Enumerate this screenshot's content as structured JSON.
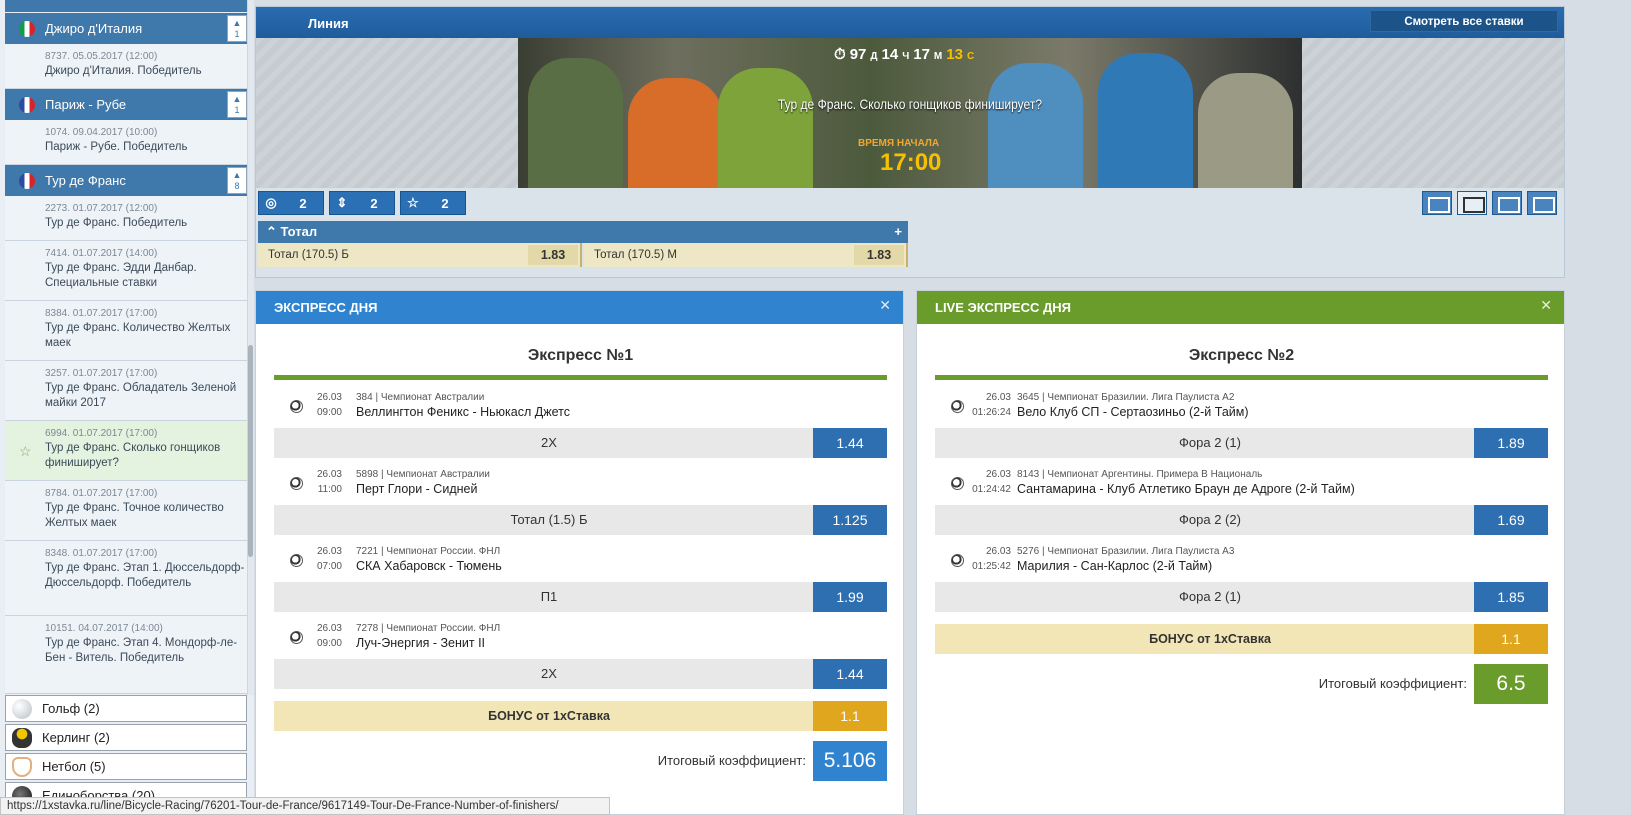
{
  "sidebar": {
    "champs": [
      {
        "name": "Джиро д'Италия",
        "count": "1"
      },
      {
        "name": "Париж - Рубе",
        "count": "1"
      },
      {
        "name": "Тур де Франс",
        "count": "8"
      }
    ],
    "events": [
      {
        "meta": "8737. 05.05.2017 (12:00)",
        "name": "Джиро д'Италия. Победитель"
      },
      {
        "meta": "1074. 09.04.2017 (10:00)",
        "name": "Париж - Рубе. Победитель"
      },
      {
        "meta": "2273. 01.07.2017 (12:00)",
        "name": "Тур де Франс. Победитель"
      },
      {
        "meta": "7414. 01.07.2017 (14:00)",
        "name": "Тур де Франс. Эдди Данбар. Специальные ставки"
      },
      {
        "meta": "8384. 01.07.2017 (17:00)",
        "name": "Тур де Франс. Количество Желтых маек"
      },
      {
        "meta": "3257. 01.07.2017 (17:00)",
        "name": "Тур де Франс. Обладатель Зеленой майки 2017"
      },
      {
        "meta": "6994. 01.07.2017 (17:00)",
        "name": "Тур де Франс. Сколько гонщиков финиширует?"
      },
      {
        "meta": "8784. 01.07.2017 (17:00)",
        "name": "Тур де Франс. Точное количество Желтых маек"
      },
      {
        "meta": "8348. 01.07.2017 (17:00)",
        "name": "Тур де Франс. Этап 1. Дюссельдорф-Дюссельдорф. Победитель"
      },
      {
        "meta": "10151. 04.07.2017 (14:00)",
        "name": "Тур де Франс. Этап 4. Мондорф-ле-Бен - Витель. Победитель"
      }
    ],
    "sports": [
      {
        "name": "Гольф (2)",
        "icon": "golf-ball-icon"
      },
      {
        "name": "Керлинг (2)",
        "icon": "curling-stone-icon"
      },
      {
        "name": "Нетбол (5)",
        "icon": "netball-hoop-icon"
      },
      {
        "name": "Единоборства (20)",
        "icon": "boxing-glove-icon"
      }
    ],
    "status_url": "https://1xstavka.ru/line/Bicycle-Racing/76201-Tour-de-France/9617149-Tour-De-France-Number-of-finishers/"
  },
  "line": {
    "title": "Линия",
    "see_all": "Смотреть все ставки",
    "timer": {
      "d": "97",
      "d_unit": "Д",
      "h": "14",
      "h_unit": "Ч",
      "m": "17",
      "m_unit": "М",
      "s": "13",
      "s_unit": "С"
    },
    "banner_title": "Тур де Франс. Сколько гонщиков финиширует?",
    "start_label": "ВРЕМЯ НАЧАЛА",
    "start_time": "17:00",
    "counters": [
      {
        "icon": "target-icon",
        "value": "2"
      },
      {
        "icon": "sort-icon",
        "value": "2"
      },
      {
        "icon": "star-icon",
        "value": "2"
      }
    ],
    "market": {
      "title": "Тотал",
      "bets": [
        {
          "label": "Тотал (170.5) Б",
          "coef": "1.83"
        },
        {
          "label": "Тотал (170.5) М",
          "coef": "1.83"
        }
      ]
    }
  },
  "express1": {
    "header": "ЭКСПРЕСС ДНЯ",
    "title": "Экспресс №1",
    "matches": [
      {
        "date": "26.03",
        "time": "09:00",
        "league": "384 | Чемпионат Австралии",
        "teams": "Веллингтон Феникс - Ньюкасл Джетс",
        "pick": "2X",
        "coef": "1.44"
      },
      {
        "date": "26.03",
        "time": "11:00",
        "league": "5898 | Чемпионат Австралии",
        "teams": "Перт Глори - Сидней",
        "pick": "Тотал (1.5) Б",
        "coef": "1.125"
      },
      {
        "date": "26.03",
        "time": "07:00",
        "league": "7221 | Чемпионат России. ФНЛ",
        "teams": "СКА Хабаровск - Тюмень",
        "pick": "П1",
        "coef": "1.99"
      },
      {
        "date": "26.03",
        "time": "09:00",
        "league": "7278 | Чемпионат России. ФНЛ",
        "teams": "Луч-Энергия - Зенит II",
        "pick": "2X",
        "coef": "1.44"
      }
    ],
    "bonus_label": "БОНУС от 1хСтавка",
    "bonus_coef": "1.1",
    "final_label": "Итоговый коэффициент:",
    "final_value": "5.106"
  },
  "express2": {
    "header": "LIVE ЭКСПРЕСС ДНЯ",
    "title": "Экспресс №2",
    "matches": [
      {
        "date": "26.03",
        "time": "01:26:24",
        "league": "3645 | Чемпионат Бразилии. Лига Паулиста А2",
        "teams": "Вело Клуб СП - Сертаозиньо (2-й Тайм)",
        "pick": "Фора 2 (1)",
        "coef": "1.89"
      },
      {
        "date": "26.03",
        "time": "01:24:42",
        "league": "8143 | Чемпионат Аргентины. Примера В Националь",
        "teams": "Сантамарина - Клуб Атлетико Браун де Адроге (2-й Тайм)",
        "pick": "Фора 2 (2)",
        "coef": "1.69"
      },
      {
        "date": "26.03",
        "time": "01:25:42",
        "league": "5276 | Чемпионат Бразилии. Лига Паулиста А3",
        "teams": "Марилия - Сан-Карлос (2-й Тайм)",
        "pick": "Фора 2 (1)",
        "coef": "1.85"
      }
    ],
    "bonus_label": "БОНУС от 1хСтавка",
    "bonus_coef": "1.1",
    "final_label": "Итоговый коэффициент:",
    "final_value": "6.5"
  },
  "colors": {
    "blue": "#2d6fb1",
    "green": "#6a9c2c",
    "gold": "#e0a61d",
    "header_blue": "#2a6cb0"
  }
}
